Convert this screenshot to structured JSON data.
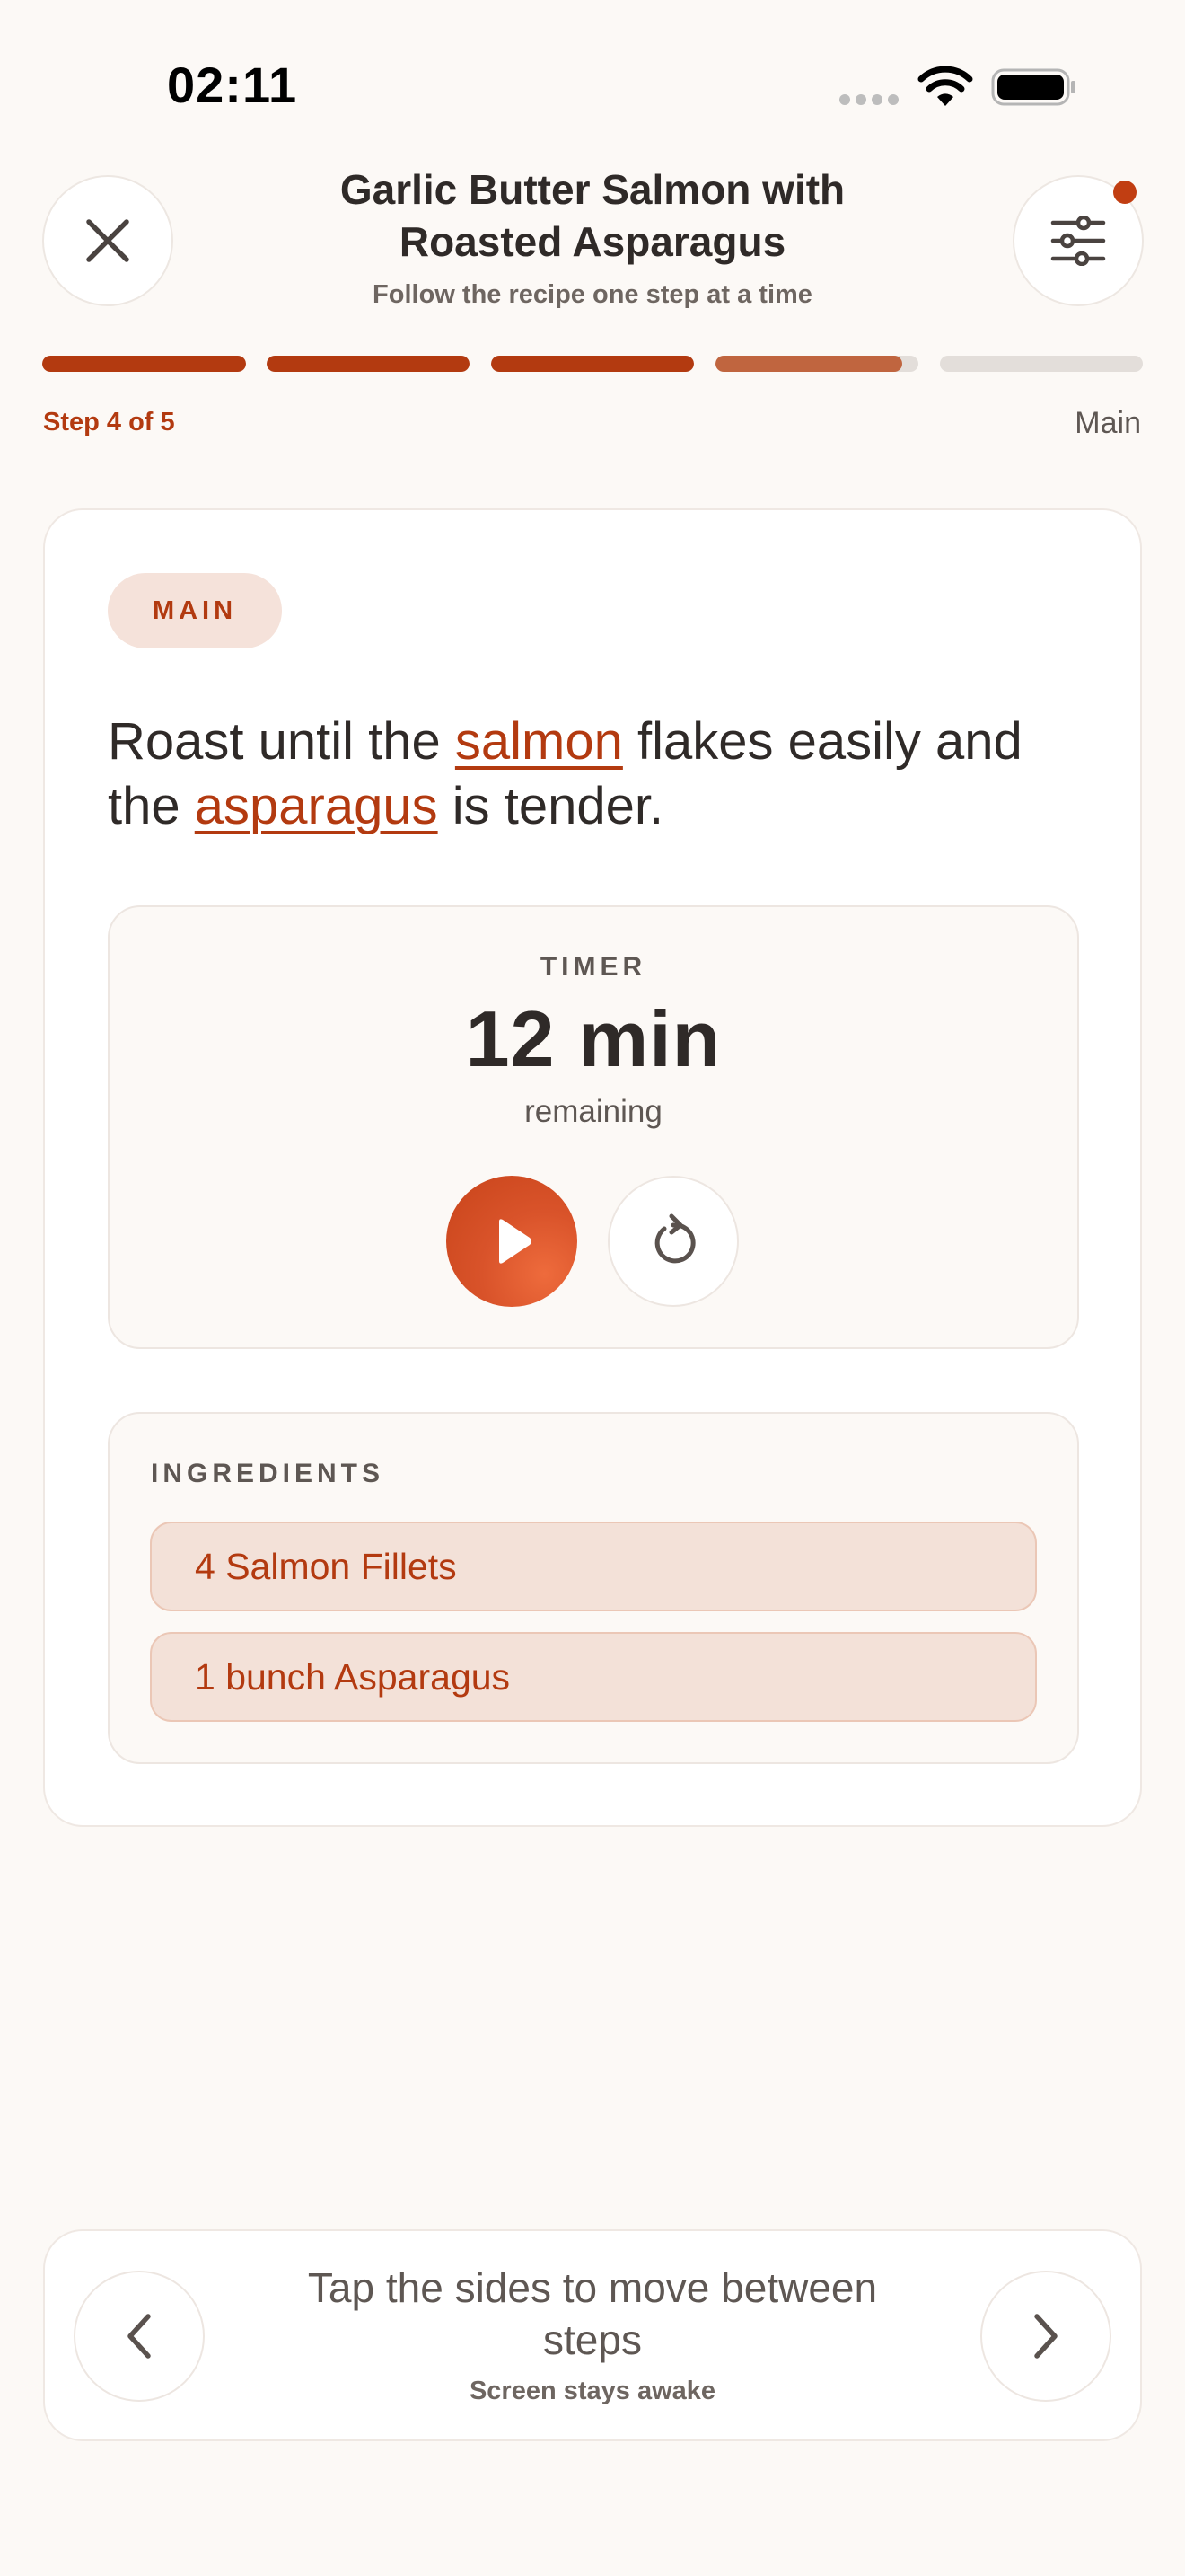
{
  "status_bar": {
    "time": "02:11",
    "icons": [
      "signal-icon",
      "wifi-icon",
      "battery-icon"
    ]
  },
  "header": {
    "title": "Garlic Butter Salmon with Roasted Asparagus",
    "subtitle": "Follow the recipe one step at a time",
    "close_icon": "close-icon",
    "settings_icon": "sliders-icon"
  },
  "progress": {
    "step_label": "Step 4 of 5",
    "section": "Main",
    "current_step": 4,
    "total_steps": 5,
    "current_step_fill": 0.92,
    "colors": {
      "done": "#B33A10",
      "current": "#C0653F",
      "todo": "#E3DEDA"
    }
  },
  "step": {
    "tag": "MAIN",
    "instruction_parts": [
      {
        "text": "Roast until the ",
        "highlight": false
      },
      {
        "text": "salmon",
        "highlight": true
      },
      {
        "text": " flakes easily and the ",
        "highlight": false
      },
      {
        "text": "asparagus",
        "highlight": true
      },
      {
        "text": " is tender.",
        "highlight": false
      }
    ]
  },
  "timer": {
    "label": "TIMER",
    "value": "12 min",
    "remaining_label": "remaining",
    "play_icon": "play-icon",
    "reset_icon": "reset-icon"
  },
  "ingredients": {
    "label": "INGREDIENTS",
    "items": [
      "4 Salmon Fillets",
      "1 bunch Asparagus"
    ]
  },
  "bottom_nav": {
    "hint": "Tap the sides to move between steps",
    "sub": "Screen stays awake",
    "prev_icon": "chevron-left-icon",
    "next_icon": "chevron-right-icon"
  },
  "accent_color": "#B33A10"
}
